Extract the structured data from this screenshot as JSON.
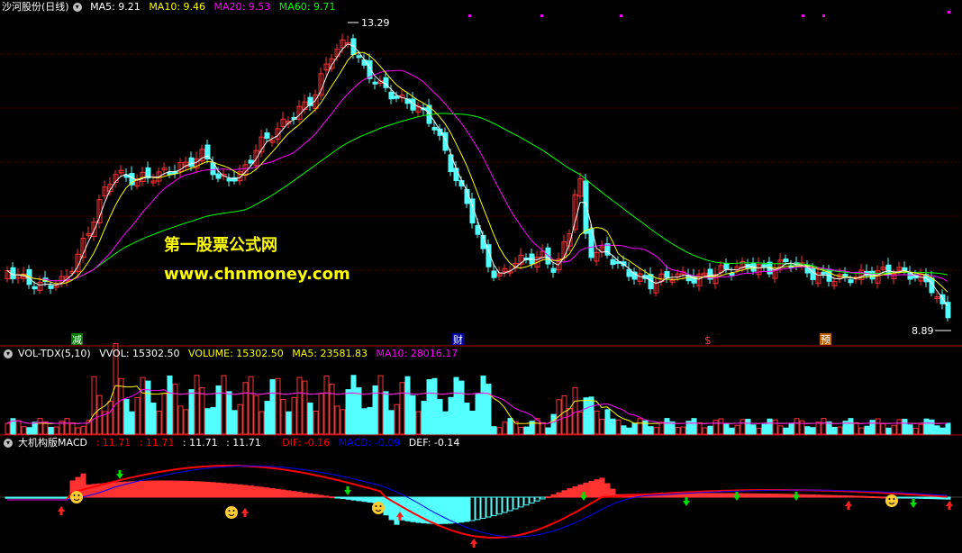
{
  "price_panel": {
    "title": "沙河股份(日线)",
    "legend": [
      {
        "label": "MA5: 9.21",
        "color": "#ffffff"
      },
      {
        "label": "MA10: 9.46",
        "color": "#ffff00"
      },
      {
        "label": "MA20: 9.53",
        "color": "#ff00ff"
      },
      {
        "label": "MA60: 9.71",
        "color": "#00ff00"
      }
    ],
    "high_label": "13.29",
    "low_label": "8.89",
    "markers": [
      "减",
      "财",
      "$",
      "预"
    ],
    "watermark_title": "第一股票公式网",
    "watermark_url": "www.chnmoney.com"
  },
  "volume_panel": {
    "title": "VOL-TDX(5,10)",
    "legend": [
      {
        "label": "VVOL: 15302.50",
        "color": "#ffffff"
      },
      {
        "label": "VOLUME: 15302.50",
        "color": "#ffff00"
      },
      {
        "label": "MA5: 23581.83",
        "color": "#ffff00"
      },
      {
        "label": "MA10: 28016.17",
        "color": "#ff00ff"
      }
    ]
  },
  "macd_panel": {
    "title": "大机构版MACD",
    "legend": [
      {
        "label": ": 11.71",
        "color": "#ff0000"
      },
      {
        "label": ": 11.71",
        "color": "#ff0000"
      },
      {
        "label": ": 11.71",
        "color": "#ffffff"
      },
      {
        "label": ": 11.71",
        "color": "#ffffff"
      },
      {
        "label": "DIF: -0.16",
        "color": "#ff0000"
      },
      {
        "label": "MACD: -0.09",
        "color": "#0000ff"
      },
      {
        "label": "DEF: -0.14",
        "color": "#ffffff"
      }
    ]
  },
  "colors": {
    "up": "#ff3232",
    "down": "#54ffff",
    "divider": "#b00000"
  }
}
